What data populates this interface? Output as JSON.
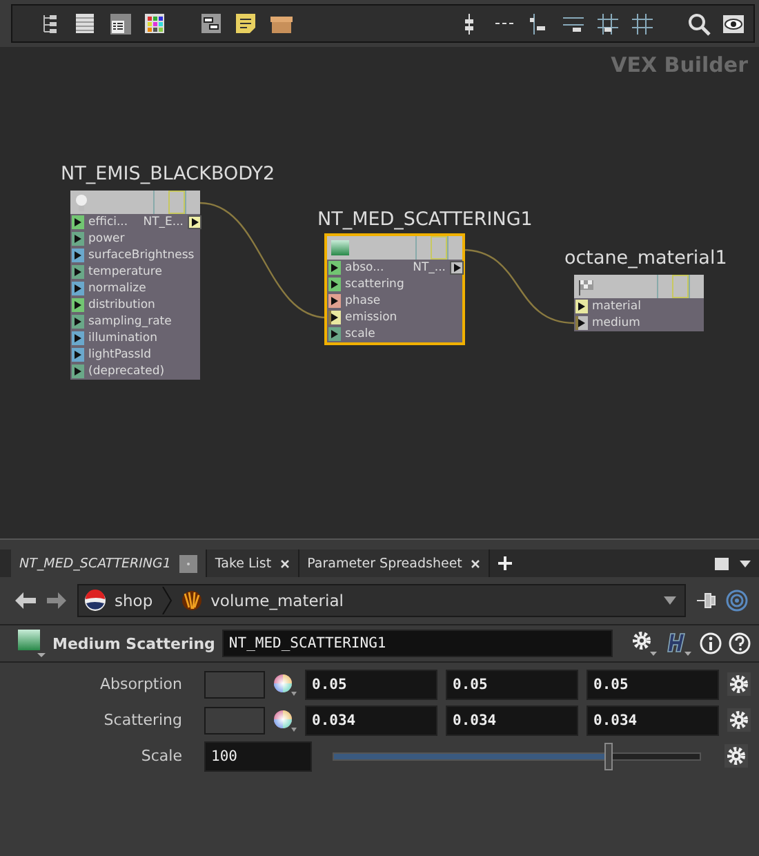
{
  "network": {
    "label": "VEX Builder"
  },
  "nodes": [
    {
      "name": "NT_EMIS_BLACKBODY2",
      "kind": "emission",
      "selected": false,
      "output": {
        "label": "NT_E...",
        "color": "#f0f0a8"
      },
      "inputs": [
        {
          "label": "effici...",
          "color": "#72c672",
          "wired": false
        },
        {
          "label": "power",
          "color": "#6aa888",
          "wired": false
        },
        {
          "label": "surfaceBrightness",
          "color": "#6aa8cc",
          "wired": false
        },
        {
          "label": "temperature",
          "color": "#6aa888",
          "wired": false
        },
        {
          "label": "normalize",
          "color": "#6aa8cc",
          "wired": false
        },
        {
          "label": "distribution",
          "color": "#72c672",
          "wired": false
        },
        {
          "label": "sampling_rate",
          "color": "#6aa888",
          "wired": false
        },
        {
          "label": "illumination",
          "color": "#6aa8cc",
          "wired": false
        },
        {
          "label": "lightPassId",
          "color": "#6aa8cc",
          "wired": false
        },
        {
          "label": "(deprecated)",
          "color": "#6aa888",
          "wired": false
        }
      ]
    },
    {
      "name": "NT_MED_SCATTERING1",
      "kind": "medium",
      "selected": true,
      "output": {
        "label": "NT_...",
        "color": "#c0c0c0"
      },
      "inputs": [
        {
          "label": "abso...",
          "color": "#72c672",
          "wired": false
        },
        {
          "label": "scattering",
          "color": "#72c672",
          "wired": false
        },
        {
          "label": "phase",
          "color": "#e0a090",
          "wired": false
        },
        {
          "label": "emission",
          "color": "#e8e8a0",
          "wired": true
        },
        {
          "label": "scale",
          "color": "#6aa888",
          "wired": false
        }
      ]
    },
    {
      "name": "octane_material1",
      "kind": "material",
      "selected": false,
      "inputs": [
        {
          "label": "material",
          "color": "#e8e8a0",
          "wired": false
        },
        {
          "label": "medium",
          "color": "#c0c0c0",
          "wired": true
        }
      ]
    }
  ],
  "pane": {
    "tabs": [
      {
        "label": "NT_MED_SCATTERING1",
        "selected": true
      },
      {
        "label": "Take List",
        "selected": false
      },
      {
        "label": "Parameter Spreadsheet",
        "selected": false
      }
    ],
    "path": [
      {
        "label": "shop",
        "kind": "context"
      },
      {
        "label": "volume_material",
        "kind": "network"
      }
    ]
  },
  "parameters": {
    "type_label": "Medium Scattering",
    "node_name": "NT_MED_SCATTERING1",
    "rows": [
      {
        "kind": "color",
        "label": "Absorption",
        "values": [
          "0.05",
          "0.05",
          "0.05"
        ]
      },
      {
        "kind": "color",
        "label": "Scattering",
        "values": [
          "0.034",
          "0.034",
          "0.034"
        ]
      },
      {
        "kind": "slider",
        "label": "Scale",
        "value": "100",
        "level": 0.75
      }
    ]
  }
}
